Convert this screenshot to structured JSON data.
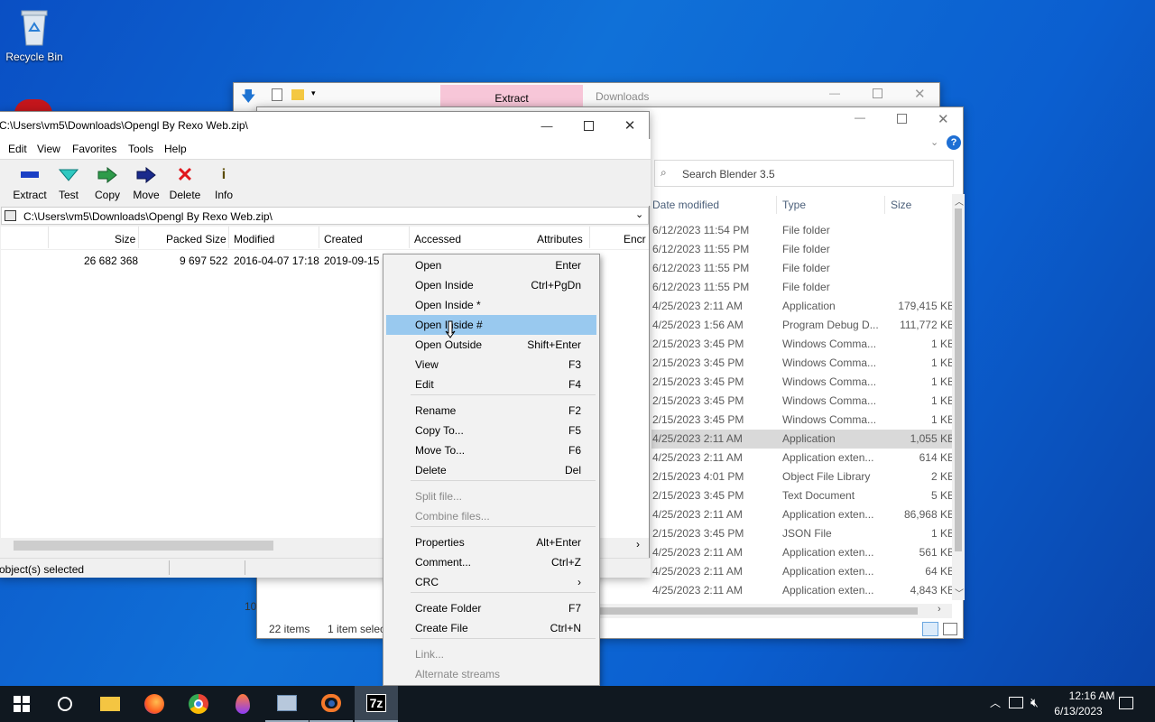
{
  "desktop": {
    "recycle_label": "Recycle Bin"
  },
  "back_window": {
    "tab_extract": "Extract",
    "tab_downloads": "Downloads"
  },
  "explorer": {
    "search_placeholder": "Search Blender 3.5",
    "columns": [
      "Date modified",
      "Type",
      "Size"
    ],
    "rows": [
      {
        "date": "6/12/2023 11:54 PM",
        "type": "File folder",
        "size": ""
      },
      {
        "date": "6/12/2023 11:55 PM",
        "type": "File folder",
        "size": ""
      },
      {
        "date": "6/12/2023 11:55 PM",
        "type": "File folder",
        "size": ""
      },
      {
        "date": "6/12/2023 11:55 PM",
        "type": "File folder",
        "size": ""
      },
      {
        "date": "4/25/2023 2:11 AM",
        "type": "Application",
        "size": "179,415 KB"
      },
      {
        "date": "4/25/2023 1:56 AM",
        "type": "Program Debug D...",
        "size": "111,772 KB"
      },
      {
        "date": "2/15/2023 3:45 PM",
        "type": "Windows Comma...",
        "size": "1 KB"
      },
      {
        "date": "2/15/2023 3:45 PM",
        "type": "Windows Comma...",
        "size": "1 KB"
      },
      {
        "date": "2/15/2023 3:45 PM",
        "type": "Windows Comma...",
        "size": "1 KB"
      },
      {
        "date": "2/15/2023 3:45 PM",
        "type": "Windows Comma...",
        "size": "1 KB"
      },
      {
        "date": "2/15/2023 3:45 PM",
        "type": "Windows Comma...",
        "size": "1 KB"
      },
      {
        "date": "4/25/2023 2:11 AM",
        "type": "Application",
        "size": "1,055 KB"
      },
      {
        "date": "4/25/2023 2:11 AM",
        "type": "Application exten...",
        "size": "614 KB"
      },
      {
        "date": "2/15/2023 4:01 PM",
        "type": "Object File Library",
        "size": "2 KB"
      },
      {
        "date": "2/15/2023 3:45 PM",
        "type": "Text Document",
        "size": "5 KB"
      },
      {
        "date": "4/25/2023 2:11 AM",
        "type": "Application exten...",
        "size": "86,968 KB"
      },
      {
        "date": "2/15/2023 3:45 PM",
        "type": "JSON File",
        "size": "1 KB"
      },
      {
        "date": "4/25/2023 2:11 AM",
        "type": "Application exten...",
        "size": "561 KB"
      },
      {
        "date": "4/25/2023 2:11 AM",
        "type": "Application exten...",
        "size": "64 KB"
      },
      {
        "date": "4/25/2023 2:11 AM",
        "type": "Application exten...",
        "size": "4,843 KB"
      }
    ],
    "status_items": "22 items",
    "status_selected": "1 item selec",
    "left_clip": "10"
  },
  "sevenzip": {
    "title": "C:\\Users\\vm5\\Downloads\\Opengl By Rexo Web.zip\\",
    "menu": [
      "Edit",
      "View",
      "Favorites",
      "Tools",
      "Help"
    ],
    "toolbar": [
      "Extract",
      "Test",
      "Copy",
      "Move",
      "Delete",
      "Info"
    ],
    "path": "C:\\Users\\vm5\\Downloads\\Opengl By Rexo Web.zip\\",
    "columns": [
      "Size",
      "Packed Size",
      "Modified",
      "Created",
      "Accessed",
      "Attributes",
      "Encr"
    ],
    "row": {
      "size": "26 682 368",
      "packed": "9 697 522",
      "modified": "2016-04-07 17:18",
      "created": "2019-09-15 0"
    },
    "status": "object(s) selected"
  },
  "context_menu": [
    {
      "label": "Open",
      "shortcut": "Enter"
    },
    {
      "label": "Open Inside",
      "shortcut": "Ctrl+PgDn"
    },
    {
      "label": "Open Inside *",
      "shortcut": ""
    },
    {
      "label": "Open Inside #",
      "shortcut": ""
    },
    {
      "label": "Open Outside",
      "shortcut": "Shift+Enter"
    },
    {
      "label": "View",
      "shortcut": "F3"
    },
    {
      "label": "Edit",
      "shortcut": "F4"
    },
    {
      "label": "Rename",
      "shortcut": "F2"
    },
    {
      "label": "Copy To...",
      "shortcut": "F5"
    },
    {
      "label": "Move To...",
      "shortcut": "F6"
    },
    {
      "label": "Delete",
      "shortcut": "Del"
    },
    {
      "label": "Split file...",
      "shortcut": ""
    },
    {
      "label": "Combine files...",
      "shortcut": ""
    },
    {
      "label": "Properties",
      "shortcut": "Alt+Enter"
    },
    {
      "label": "Comment...",
      "shortcut": "Ctrl+Z"
    },
    {
      "label": "CRC",
      "shortcut": "›"
    },
    {
      "label": "Create Folder",
      "shortcut": "F7"
    },
    {
      "label": "Create File",
      "shortcut": "Ctrl+N"
    },
    {
      "label": "Link...",
      "shortcut": ""
    },
    {
      "label": "Alternate streams",
      "shortcut": ""
    }
  ],
  "taskbar": {
    "time": "12:16 AM",
    "date": "6/13/2023",
    "app_7z": "7z"
  },
  "colors": {
    "highlight": "#99c9ef",
    "taskbar": "#101820",
    "desktop": "#0b5fd0"
  }
}
